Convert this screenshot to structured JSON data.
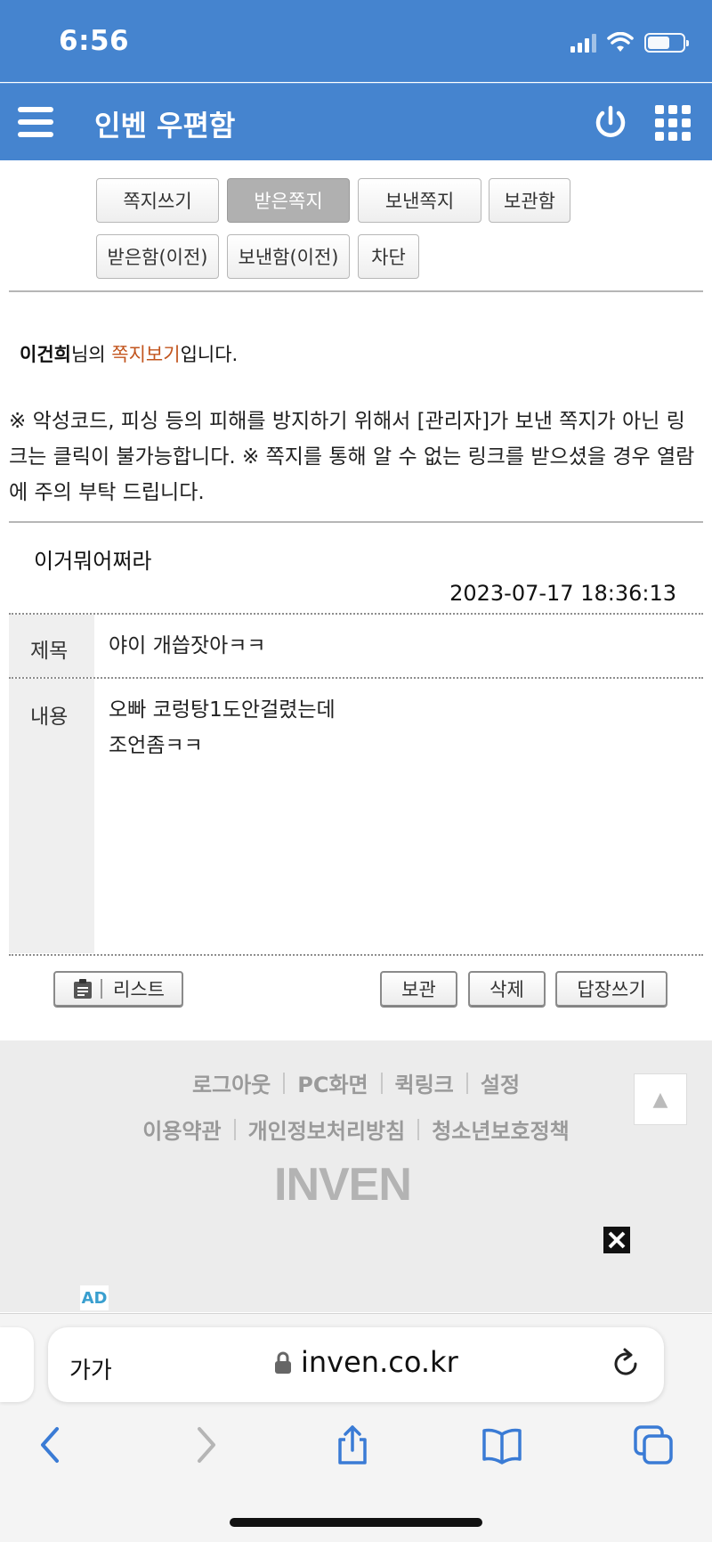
{
  "status_bar": {
    "time": "6:56"
  },
  "header": {
    "title": "인벤 우편함"
  },
  "tabs": {
    "compose": "쪽지쓰기",
    "received": "받은쪽지",
    "sent": "보낸쪽지",
    "storage": "보관함",
    "received_old": "받은함(이전)",
    "sent_old": "보낸함(이전)",
    "block": "차단"
  },
  "owner": {
    "name": "이건희",
    "suffix1": "님의 ",
    "highlight": "쪽지보기",
    "suffix2": "입니다."
  },
  "notice": "※ 악성코드, 피싱 등의 피해를 방지하기 위해서 [관리자]가 보낸 쪽지가 아닌 링크는 클릭이 불가능합니다. ※ 쪽지를 통해 알 수 없는 링크를 받으셨을 경우 열람에 주의 부탁 드립니다.",
  "message": {
    "sender": "이거뭐어쩌라",
    "date": "2023-07-17 18:36:13",
    "subject_label": "제목",
    "subject": "야이 개씁잣아ㅋㅋ",
    "content_label": "내용",
    "content_line1": "오빠 코렁탕1도안걸렸는데",
    "content_line2": "조언좀ㅋㅋ"
  },
  "actions": {
    "list": "리스트",
    "keep": "보관",
    "delete": "삭제",
    "reply": "답장쓰기"
  },
  "footer": {
    "links_row1": [
      "로그아웃",
      "PC화면",
      "퀵링크",
      "설정"
    ],
    "links_row2": [
      "이용약관",
      "개인정보처리방침",
      "청소년보호정책"
    ],
    "logo": "INVEN",
    "top_arrow": "▲",
    "ad_badge": "AD"
  },
  "browser": {
    "aa": "가가",
    "url": "inven.co.kr"
  },
  "colors": {
    "brand_blue": "#4584cf",
    "highlight_orange": "#c2551e",
    "footer_bg": "#ececec"
  }
}
